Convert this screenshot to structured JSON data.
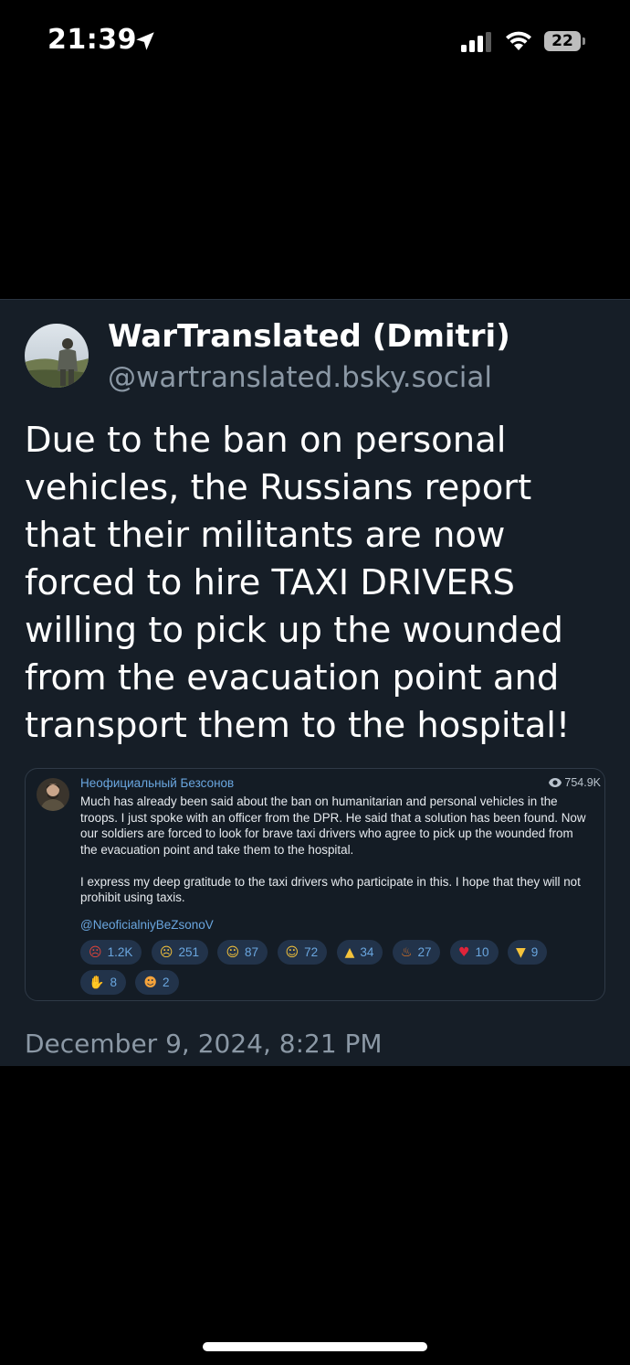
{
  "status_bar": {
    "time": "21:39",
    "battery_level": "22",
    "icons": [
      "location-arrow-icon",
      "cellular-signal-icon",
      "wifi-icon",
      "battery-icon"
    ]
  },
  "post": {
    "author_name": "WarTranslated (Dmitri)",
    "author_handle": "@wartranslated.bsky.social",
    "text": "Due to the ban on personal vehicles, the Russians report that their militants are now forced to hire TAXI DRIVERS willing to pick up the wounded from the evacuation point and transport them to the hospital!",
    "timestamp": "December 9, 2024, 8:21 PM"
  },
  "quote": {
    "channel_name": "Неофициальный Безсонов",
    "views": "754.9K",
    "paragraph_1": "Much has already been said about the ban on humanitarian and personal vehicles in the troops. I just spoke with an officer from the DPR. He said that a solution has been found. Now our soldiers are forced to look for brave taxi drivers who agree to pick up the wounded from the evacuation point and take them to the hospital.",
    "paragraph_2": "I express my deep gratitude to the taxi drivers who participate in this. I hope that they will not prohibit using taxis.",
    "link": "@NeoficialniyBeZsonoV",
    "reactions": [
      {
        "icon": "angry-face-icon",
        "count": "1.2K"
      },
      {
        "icon": "crying-face-icon",
        "count": "251"
      },
      {
        "icon": "grinning-face-icon",
        "count": "87"
      },
      {
        "icon": "thinking-face-icon",
        "count": "72"
      },
      {
        "icon": "thumbs-up-icon",
        "count": "34"
      },
      {
        "icon": "fire-icon",
        "count": "27"
      },
      {
        "icon": "red-heart-icon",
        "count": "10"
      },
      {
        "icon": "thumbs-down-icon",
        "count": "9"
      },
      {
        "icon": "clapping-hands-icon",
        "count": "8"
      },
      {
        "icon": "smiling-face-with-hearts-icon",
        "count": "2"
      }
    ]
  },
  "colors": {
    "card_background": "#161e27",
    "link_blue": "#6aa6df",
    "muted_text": "#8b98a5"
  }
}
